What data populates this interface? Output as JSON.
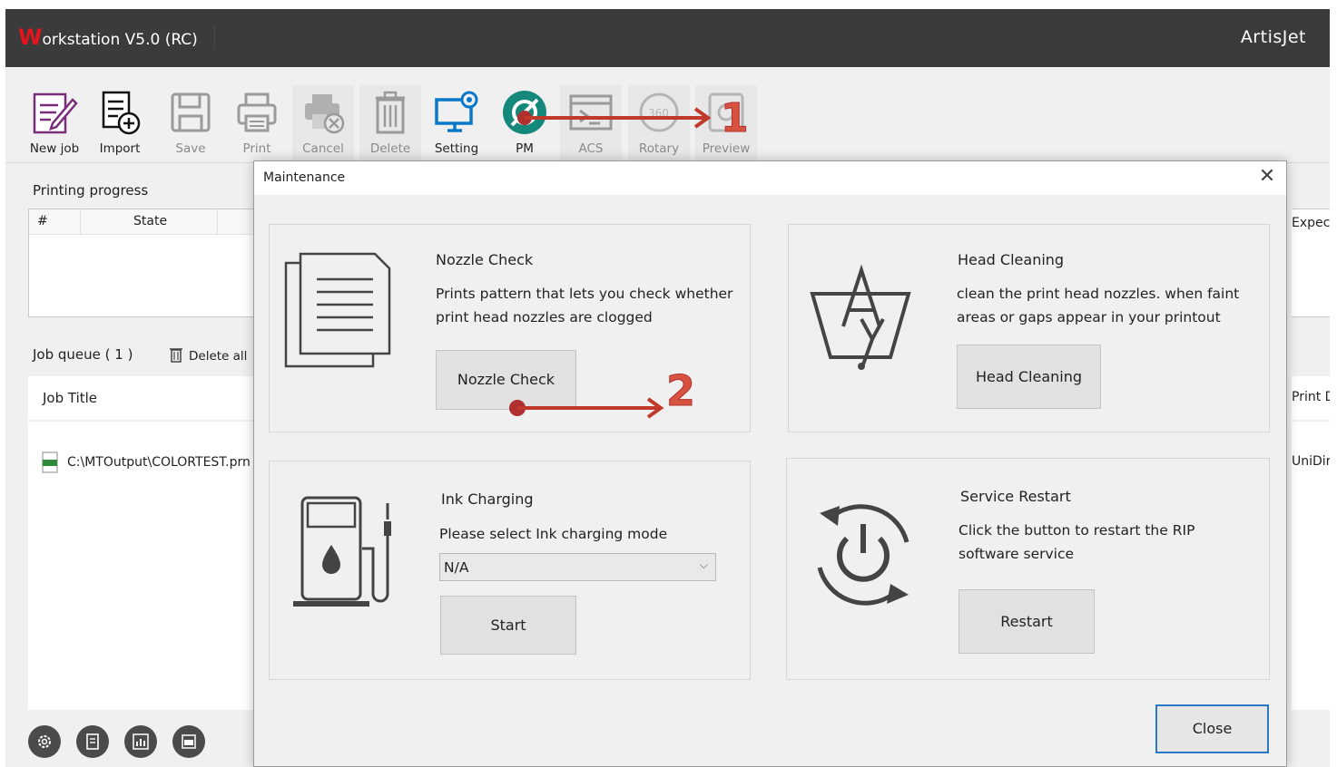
{
  "app": {
    "title_first_letter": "W",
    "title_rest": "orkstation V5.0 (RC)",
    "brand": "ArtisJet"
  },
  "toolbar": {
    "new_job": "New job",
    "import": "Import",
    "save": "Save",
    "print": "Print",
    "cancel": "Cancel",
    "delete": "Delete",
    "setting": "Setting",
    "pm": "PM",
    "acs": "ACS",
    "rotary": "Rotary",
    "preview": "Preview"
  },
  "progress": {
    "title": "Printing progress",
    "col_hash": "#",
    "col_state": "State"
  },
  "queue": {
    "title": "Job queue ( 1 )",
    "delete_all": "Delete all",
    "job_title_header": "Job Title",
    "jobs": [
      {
        "path": "C:\\MTOutput\\COLORTEST.prn"
      }
    ]
  },
  "right_fragments": {
    "expected": "Expecte",
    "print_dir": "Print Di",
    "unidir": "UniDir"
  },
  "dialog": {
    "title": "Maintenance",
    "close_x": "✕",
    "nozzle": {
      "heading": "Nozzle Check",
      "desc_line1": "Prints pattern that lets you check whether",
      "desc_line2": "print head nozzles are clogged",
      "button": "Nozzle Check"
    },
    "head": {
      "heading": "Head Cleaning",
      "desc_line1": "clean the print head nozzles.  when faint",
      "desc_line2": "areas or gaps appear in your printout",
      "button": "Head Cleaning"
    },
    "ink": {
      "heading": "Ink Charging",
      "desc": "Please select Ink charging mode",
      "select_value": "N/A",
      "button": "Start"
    },
    "service": {
      "heading": "Service Restart",
      "desc_line1": "Click the button to restart the RIP",
      "desc_line2": "software service",
      "button": "Restart"
    },
    "close_button": "Close"
  },
  "annotations": {
    "step1": "1",
    "step2": "2",
    "arrow_color": "#c0392b"
  }
}
